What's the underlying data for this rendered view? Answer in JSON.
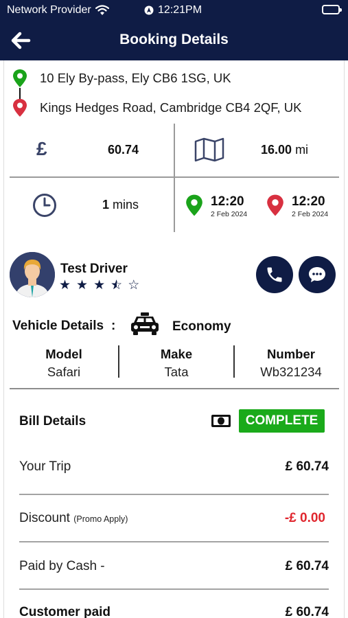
{
  "status_bar": {
    "carrier": "Network Provider",
    "time": "12:21PM"
  },
  "header": {
    "title": "Booking Details"
  },
  "route": {
    "pickup": "10 Ely By-pass, Ely CB6 1SG, UK",
    "dropoff": "Kings Hedges Road, Cambridge CB4 2QF, UK"
  },
  "stats": {
    "fare_symbol": "£",
    "fare": "60.74",
    "distance": "16.00",
    "distance_unit": "mi",
    "duration_value": "1",
    "duration_unit": "mins",
    "pickup_time": "12:20",
    "pickup_date": "2 Feb 2024",
    "dropoff_time": "12:20",
    "dropoff_date": "2 Feb 2024"
  },
  "driver": {
    "name": "Test Driver",
    "rating": 3.5,
    "rating_max": 5
  },
  "vehicle": {
    "label": "Vehicle Details",
    "colon": ":",
    "class": "Economy",
    "columns": [
      {
        "header": "Model",
        "value": "Safari"
      },
      {
        "header": "Make",
        "value": "Tata"
      },
      {
        "header": "Number",
        "value": "Wb321234"
      }
    ]
  },
  "bill": {
    "title": "Bill Details",
    "status": "COMPLETE",
    "rows": [
      {
        "label": "Your Trip",
        "note": "",
        "amount": "£ 60.74"
      },
      {
        "label": "Discount",
        "note": "(Promo Apply)",
        "amount": "-£ 0.00"
      },
      {
        "label": "Paid by Cash -",
        "note": "",
        "amount": "£ 60.74"
      },
      {
        "label": "Customer paid",
        "note": "",
        "amount": "£ 60.74"
      }
    ]
  },
  "colors": {
    "navy": "#0f1c45",
    "pickup_pin": "#1aa31a",
    "dropoff_pin": "#d83040",
    "complete_bg": "#1aaa1a",
    "discount_red": "#e0262e"
  },
  "icons": {
    "back": "arrow-left-icon",
    "wifi": "wifi-icon",
    "location_services": "location-arrow-icon",
    "pickup": "map-pin-green-icon",
    "dropoff": "map-pin-red-icon",
    "fare": "pound-icon",
    "distance": "folded-map-icon",
    "duration": "clock-icon",
    "call": "phone-icon",
    "chat": "chat-bubble-icon",
    "vehicle": "taxi-icon",
    "payment": "cash-icon"
  }
}
